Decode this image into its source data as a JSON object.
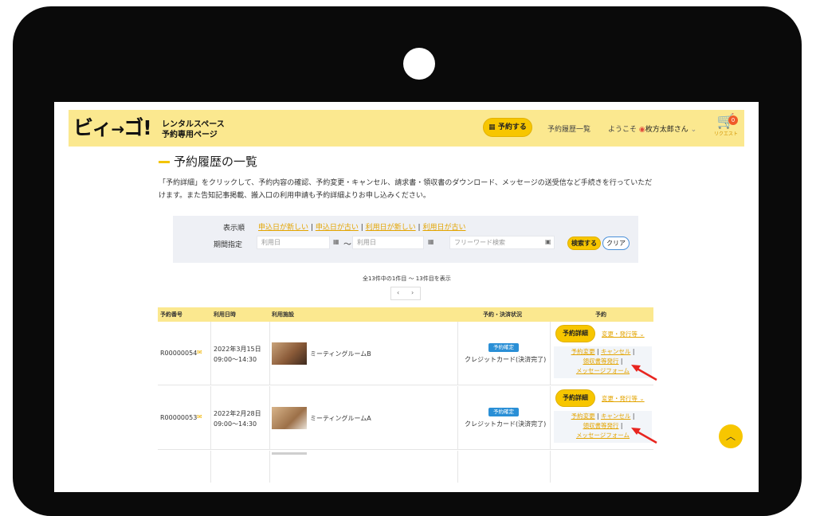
{
  "header": {
    "logo_main": "ビィ",
    "logo_arrow": "→",
    "logo_end": "ゴ!",
    "logo_sub_line1": "レンタルスペース",
    "logo_sub_line2": "予約専用ページ",
    "reserve_button": "予約する",
    "nav_history": "予約履歴一覧",
    "welcome_prefix": "ようこそ",
    "user_name": "枚方太郎さん",
    "cart_badge": "0",
    "cart_label": "リクエスト"
  },
  "page": {
    "title": "予約履歴の一覧",
    "intro": "「予約詳細」をクリックして、予約内容の確認、予約変更・キャンセル、請求書・領収書のダウンロード、メッセージの送受信など手続きを行っていただけます。また告知記事掲載、搬入口の利用申請も予約詳細よりお申し込みください。"
  },
  "filter": {
    "sort_label": "表示順",
    "sort_options": [
      "申込日が新しい",
      "申込日が古い",
      "利用日が新しい",
      "利用日が古い"
    ],
    "period_label": "期間指定",
    "date_from_placeholder": "利用日",
    "date_to_placeholder": "利用日",
    "tilde": "〜",
    "keyword_placeholder": "フリーワード検索",
    "search_button": "検索する",
    "clear_button": "クリア"
  },
  "pagination": {
    "summary": "全13件中の1件目 〜 13件目を表示",
    "prev": "‹",
    "next": "›"
  },
  "table": {
    "headers": [
      "予約番号",
      "利用日時",
      "利用施設",
      "予約・決済状況",
      "予約"
    ],
    "rows": [
      {
        "id": "R00000054",
        "date": "2022年3月15日",
        "time": "09:00〜14:30",
        "facility": "ミーティングルームB",
        "status": "予約確定",
        "payment": "クレジットカード(決済完了)",
        "detail_button": "予約詳細",
        "change_menu": "変更・発行等",
        "link_change": "予約変更",
        "link_cancel": "キャンセル",
        "link_receipt": "領収書等発行",
        "link_message": "メッセージフォーム"
      },
      {
        "id": "R00000053",
        "date": "2022年2月28日",
        "time": "09:00〜14:30",
        "facility": "ミーティングルームA",
        "status": "予約確定",
        "payment": "クレジットカード(決済完了)",
        "detail_button": "予約詳細",
        "change_menu": "変更・発行等",
        "link_change": "予約変更",
        "link_cancel": "キャンセル",
        "link_receipt": "領収書等発行",
        "link_message": "メッセージフォーム"
      }
    ]
  },
  "separator": "|",
  "colors": {
    "brand_yellow": "#f7c600",
    "header_bg": "#fbe88f",
    "link": "#e3a400",
    "status_blue": "#2a8fd6",
    "annotation_red": "#e8251f"
  }
}
